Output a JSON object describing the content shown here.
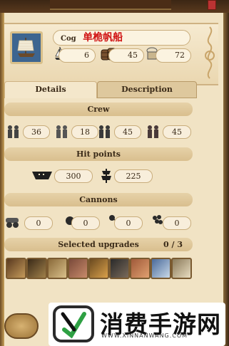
{
  "ship": {
    "name": "Cog",
    "name_cn": "单桅帆船",
    "stats": {
      "speed": "6",
      "cargo": "45",
      "crew_capacity": "72"
    },
    "icon": "sailing-ship-icon"
  },
  "tabs": [
    {
      "label": "Details",
      "active": true
    },
    {
      "label": "Description",
      "active": false
    }
  ],
  "sections": {
    "crew": {
      "title": "Crew",
      "values": [
        {
          "icon": "sailors-icon",
          "value": "36"
        },
        {
          "icon": "soldiers-icon",
          "value": "18"
        },
        {
          "icon": "musketeers-icon",
          "value": "45"
        },
        {
          "icon": "officers-icon",
          "value": "45"
        }
      ]
    },
    "hit_points": {
      "title": "Hit points",
      "values": [
        {
          "icon": "hull-icon",
          "value": "300"
        },
        {
          "icon": "sails-icon",
          "value": "225"
        }
      ]
    },
    "cannons": {
      "title": "Cannons",
      "values": [
        {
          "icon": "cannon-icon",
          "value": "0"
        },
        {
          "icon": "cannonball-icon",
          "value": "0"
        },
        {
          "icon": "chain-shot-icon",
          "value": "0"
        },
        {
          "icon": "grape-shot-icon",
          "value": "0"
        }
      ]
    },
    "upgrades": {
      "title": "Selected upgrades",
      "count": "0 / 3",
      "slots": [
        "planks-upgrade-icon",
        "rigging-upgrade-icon",
        "hull-upgrade-icon",
        "crew-upgrade-icon",
        "deck-upgrade-icon",
        "cannon-upgrade-icon",
        "cargo-upgrade-icon",
        "sail-upgrade-icon",
        "lantern-upgrade-icon"
      ]
    }
  },
  "watermark": {
    "text": "消费手游网",
    "url": "WWW.XINNANWANG.COM"
  },
  "colors": {
    "panel": "#f1e3c4",
    "section_bar": "#d9bf8e",
    "accent_red": "#d01414"
  }
}
